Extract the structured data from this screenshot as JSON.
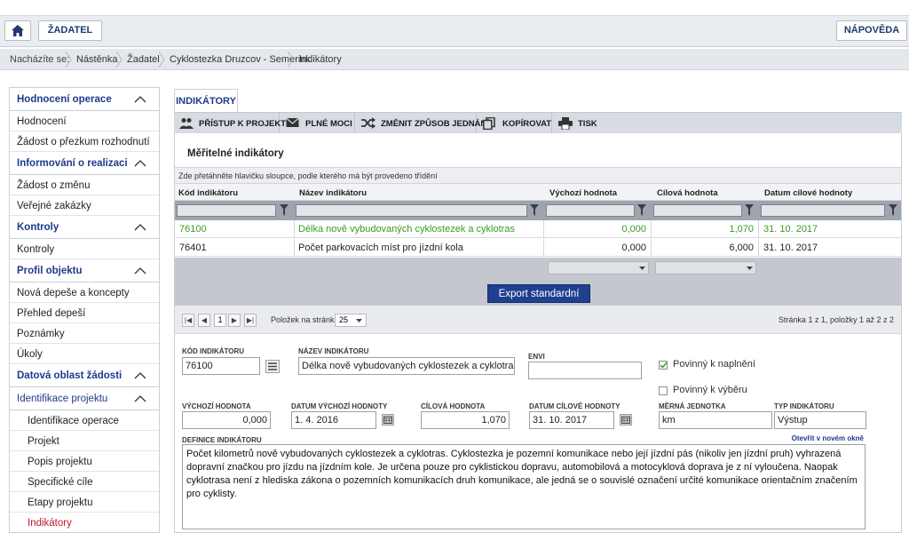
{
  "header": {
    "zadatel_label": "ŽADATEL",
    "help_label": "NÁPOVĚDA"
  },
  "breadcrumb": {
    "prefix": "Nacházíte se:",
    "items": [
      "Nástěnka",
      "Žadatel",
      "Cyklostezka Druzcov - Semerink",
      "Indikátory"
    ]
  },
  "sidebar": {
    "sections": [
      {
        "title": "Hodnocení operace",
        "items": [
          "Hodnocení",
          "Žádost o přezkum rozhodnutí"
        ]
      },
      {
        "title": "Informování o realizaci",
        "items": [
          "Žádost o změnu",
          "Veřejné zakázky"
        ]
      },
      {
        "title": "Kontroly",
        "items": [
          "Kontroly"
        ]
      },
      {
        "title": "Profil objektu",
        "items": [
          "Nová depeše a koncepty",
          "Přehled depeší",
          "Poznámky",
          "Úkoly"
        ]
      },
      {
        "title": "Datová oblast žádosti",
        "items": []
      }
    ],
    "project_header": "Identifikace projektu",
    "project_items": [
      "Identifikace operace",
      "Projekt",
      "Popis projektu",
      "Specifické cíle",
      "Etapy projektu",
      "Indikátory"
    ]
  },
  "tab_label": "INDIKÁTORY",
  "toolbar": {
    "access": "PŘÍSTUP K PROJEKTU",
    "power": "PLNÉ MOCI",
    "change": "ZMĚNIT ZPŮSOB JEDNÁNÍ",
    "copy": "KOPÍROVAT",
    "print": "TISK"
  },
  "section_title": "Měřitelné indikátory",
  "grid": {
    "hint": "Zde přetáhněte hlavičku sloupce, podle kterého má být provedeno třídění",
    "columns": [
      "Kód indikátoru",
      "Název indikátoru",
      "Výchozí hodnota",
      "Cílová hodnota",
      "Datum cílové hodnoty"
    ],
    "rows": [
      {
        "code": "76100",
        "name": "Délka nově vybudovaných cyklostezek a cyklotras",
        "start": "0,000",
        "target": "1,070",
        "date": "31. 10. 2017"
      },
      {
        "code": "76401",
        "name": "Počet parkovacích míst pro jízdní kola",
        "start": "0,000",
        "target": "6,000",
        "date": "31. 10. 2017"
      }
    ]
  },
  "export_label": "Export standardní",
  "pager": {
    "current_page": "1",
    "page_size_label": "Položek na stránku",
    "page_size": "25",
    "summary": "Stránka 1 z 1, položky 1 až 2 z 2"
  },
  "detail": {
    "code_label": "KÓD INDIKÁTORU",
    "code": "76100",
    "name_label": "NÁZEV INDIKÁTORU",
    "name": "Délka nově vybudovaných cyklostezek a cyklotras",
    "envi_label": "ENVI",
    "envi": "",
    "mandatory_fulfil": "Povinný k naplnění",
    "mandatory_select": "Povinný k výběru",
    "start_label": "VÝCHOZÍ HODNOTA",
    "start": "0,000",
    "start_date_label": "DATUM VÝCHOZÍ HODNOTY",
    "start_date": "1. 4. 2016",
    "target_label": "CÍLOVÁ HODNOTA",
    "target": "1,070",
    "target_date_label": "DATUM CÍLOVÉ HODNOTY",
    "target_date": "31. 10. 2017",
    "unit_label": "MĚRNÁ JEDNOTKA",
    "unit": "km",
    "type_label": "TYP INDIKÁTORU",
    "type": "Výstup",
    "definition_label": "DEFINICE INDIKÁTORU",
    "open_new_window": "Otevřít v novém okně",
    "definition": "Počet kilometrů nově vybudovaných cyklostezek a cyklotras. Cyklostezka je pozemní komunikace nebo její jízdní pás (nikoliv jen jízdní pruh) vyhrazená dopravní značkou pro jízdu na jízdním kole. Je určena pouze pro cyklistickou dopravu, automobilová a motocyklová doprava je z ní vyloučena. Naopak cyklotrasa není z hlediska zákona o pozemních komunikacích druh komunikace, ale jedná se o souvislé označení určité komunikace orientačním značením pro cyklisty."
  },
  "colors": {
    "accent": "#1f3a8a",
    "green": "#3b9a26",
    "active": "#c0182c"
  }
}
